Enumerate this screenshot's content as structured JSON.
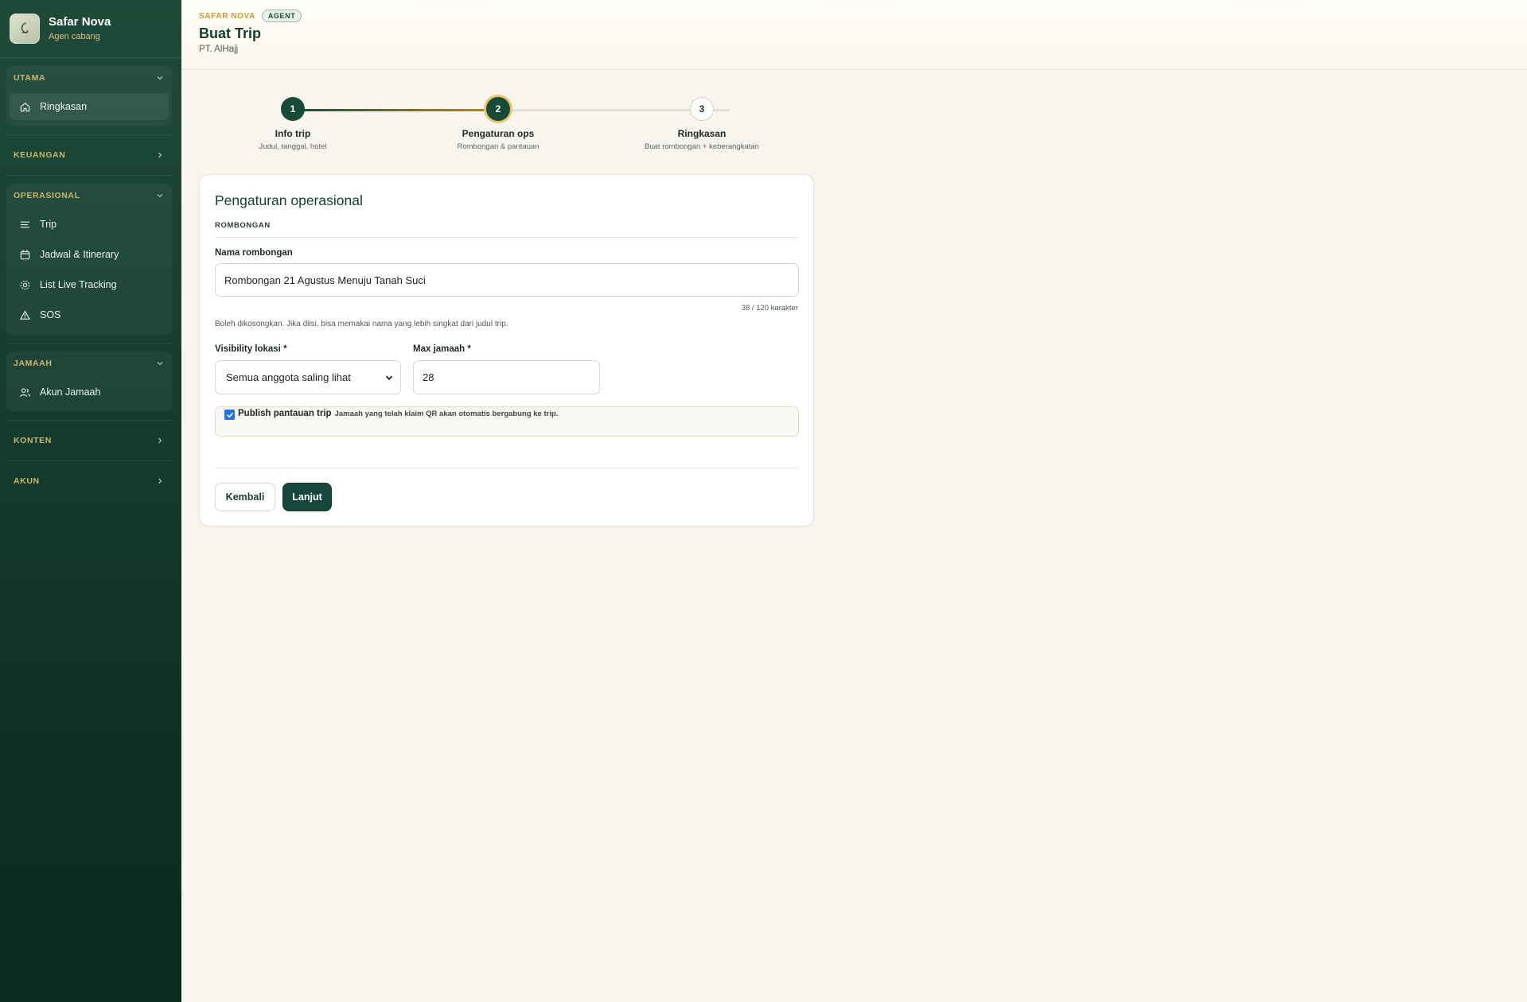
{
  "brand": {
    "name": "Safar Nova",
    "subtitle": "Agen cabang"
  },
  "sidebar": {
    "utama": {
      "title": "UTAMA",
      "items": [
        {
          "label": "Ringkasan",
          "icon": "home-icon"
        }
      ]
    },
    "keuangan": {
      "title": "KEUANGAN"
    },
    "operasional": {
      "title": "OPERASIONAL",
      "items": [
        {
          "label": "Trip",
          "icon": "list-icon"
        },
        {
          "label": "Jadwal & Itinerary",
          "icon": "calendar-icon"
        },
        {
          "label": "List Live Tracking",
          "icon": "gear-icon"
        },
        {
          "label": "SOS",
          "icon": "warning-icon"
        }
      ]
    },
    "jamaah": {
      "title": "JAMAAH",
      "items": [
        {
          "label": "Akun Jamaah",
          "icon": "users-icon"
        }
      ]
    },
    "konten": {
      "title": "KONTEN"
    },
    "akun": {
      "title": "AKUN"
    }
  },
  "header": {
    "brand": "SAFAR NOVA",
    "badge": "AGENT",
    "title": "Buat Trip",
    "subtitle": "PT. AlHajj"
  },
  "stepper": {
    "steps": [
      {
        "number": "1",
        "label": "Info trip",
        "desc": "Judul, tanggal, hotel",
        "state": "done"
      },
      {
        "number": "2",
        "label": "Pengaturan ops",
        "desc": "Rombongan & pantauan",
        "state": "current"
      },
      {
        "number": "3",
        "label": "Ringkasan",
        "desc": "Buat rombongan + keberangkatan",
        "state": "todo"
      }
    ]
  },
  "form": {
    "title": "Pengaturan operasional",
    "section": "ROMBONGAN",
    "nama_label": "Nama rombongan",
    "nama_value": "Rombongan 21 Agustus Menuju Tanah Suci",
    "counter": "38 / 120 karakter",
    "hint": "Boleh dikosongkan. Jika diisi, bisa memakai nama yang lebih singkat dari judul trip.",
    "visibility_label": "Visibility lokasi *",
    "visibility_value": "Semua anggota saling lihat",
    "max_label": "Max jamaah *",
    "max_value": "28",
    "publish_label": "Publish pantauan trip",
    "publish_desc": "Jamaah yang telah klaim QR akan otomatis bergabung ke trip.",
    "publish_checked": true,
    "back_label": "Kembali",
    "next_label": "Lanjut"
  },
  "colors": {
    "sidebar": "#153d2f",
    "accent_gold": "#c59d38",
    "primary": "#16473a",
    "background": "#f8f5ef"
  }
}
